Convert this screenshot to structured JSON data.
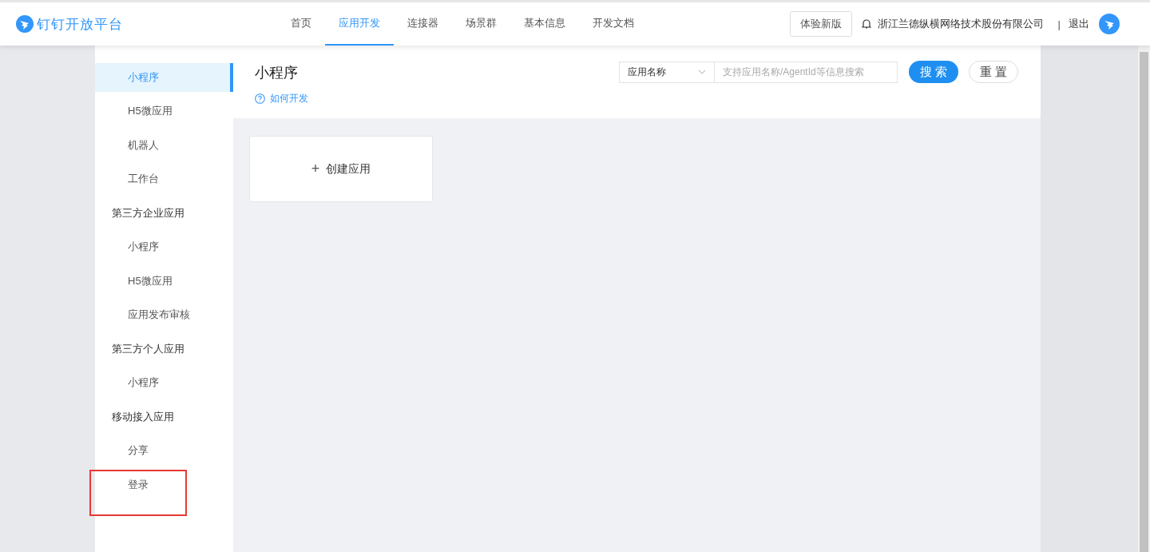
{
  "header": {
    "logo_text": "钉钉开放平台",
    "nav": [
      {
        "label": "首页",
        "selected": false
      },
      {
        "label": "应用开发",
        "selected": true
      },
      {
        "label": "连接器",
        "selected": false
      },
      {
        "label": "场景群",
        "selected": false
      },
      {
        "label": "基本信息",
        "selected": false
      },
      {
        "label": "开发文档",
        "selected": false
      }
    ],
    "try_new_button": "体验新版",
    "company": "浙江兰德纵横网络技术股份有限公司",
    "separator": "|",
    "logout": "退出"
  },
  "sidebar": {
    "items": [
      {
        "kind": "item",
        "label": "小程序",
        "selected": true,
        "highlighted": false
      },
      {
        "kind": "item",
        "label": "H5微应用",
        "selected": false,
        "highlighted": false
      },
      {
        "kind": "item",
        "label": "机器人",
        "selected": false,
        "highlighted": false
      },
      {
        "kind": "item",
        "label": "工作台",
        "selected": false,
        "highlighted": false
      },
      {
        "kind": "group",
        "label": "第三方企业应用"
      },
      {
        "kind": "item",
        "label": "小程序",
        "selected": false,
        "highlighted": false
      },
      {
        "kind": "item",
        "label": "H5微应用",
        "selected": false,
        "highlighted": false
      },
      {
        "kind": "item",
        "label": "应用发布审核",
        "selected": false,
        "highlighted": false
      },
      {
        "kind": "group",
        "label": "第三方个人应用"
      },
      {
        "kind": "item",
        "label": "小程序",
        "selected": false,
        "highlighted": false
      },
      {
        "kind": "group",
        "label": "移动接入应用"
      },
      {
        "kind": "item",
        "label": "分享",
        "selected": false,
        "highlighted": false
      },
      {
        "kind": "item",
        "label": "登录",
        "selected": false,
        "highlighted": true
      }
    ]
  },
  "main": {
    "title": "小程序",
    "help_link": "如何开发",
    "search": {
      "filter": "应用名称",
      "placeholder": "支持应用名称/AgentId等信息搜索",
      "search_button": "搜 索",
      "reset_button": "重 置"
    },
    "create_card": {
      "plus": "+",
      "label": "创建应用"
    }
  }
}
